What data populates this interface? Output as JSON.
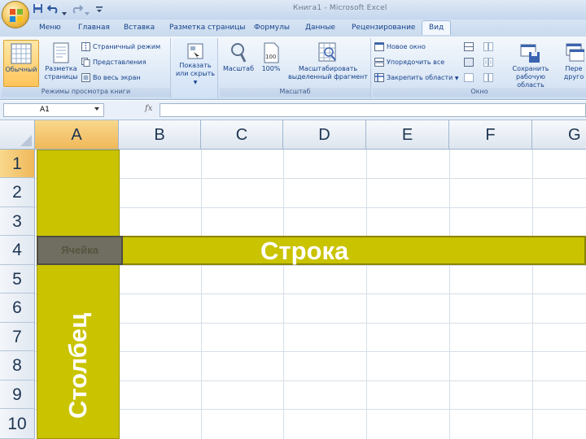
{
  "window": {
    "title": "Книга1 - Microsoft Excel",
    "qat_icons": [
      "save-icon",
      "undo-icon",
      "redo-icon",
      "customize-icon"
    ]
  },
  "tabs": [
    {
      "label": "Меню"
    },
    {
      "label": "Главная"
    },
    {
      "label": "Вставка"
    },
    {
      "label": "Разметка страницы"
    },
    {
      "label": "Формулы"
    },
    {
      "label": "Данные"
    },
    {
      "label": "Рецензирование"
    },
    {
      "label": "Вид",
      "active": true
    }
  ],
  "ribbon": {
    "views_group": {
      "label": "Режимы просмотра книги",
      "normal": "Обычный",
      "page_layout_1": "Разметка",
      "page_layout_2": "страницы",
      "page_break": "Страничный режим",
      "custom_views": "Представления",
      "full_screen": "Во весь экран"
    },
    "show_group": {
      "show_hide_1": "Показать",
      "show_hide_2": "или скрыть"
    },
    "zoom_group": {
      "label": "Масштаб",
      "zoom": "Масштаб",
      "zoom100": "100%",
      "zoom_sel_1": "Масштабировать",
      "zoom_sel_2": "выделенный фрагмент"
    },
    "window_group": {
      "label": "Окно",
      "new_window": "Новое окно",
      "arrange_all": "Упорядочить все",
      "freeze": "Закрепить области",
      "save_ws_1": "Сохранить",
      "save_ws_2": "рабочую область",
      "switch_1": "Пере",
      "switch_2": "друго"
    }
  },
  "formula_bar": {
    "namebox": "A1",
    "fx": "fx",
    "formula": ""
  },
  "sheet": {
    "columns": [
      "A",
      "B",
      "C",
      "D",
      "E",
      "F",
      "G"
    ],
    "rows": [
      "1",
      "2",
      "3",
      "4",
      "5",
      "6",
      "7",
      "8",
      "9",
      "10"
    ],
    "selected_column": "A",
    "selected_row": "1",
    "cell_label": "Ячейка",
    "row_label": "Строка",
    "column_label": "Столбец",
    "highlight_color": "#c9c300",
    "cell_color": "#6f6e60"
  }
}
